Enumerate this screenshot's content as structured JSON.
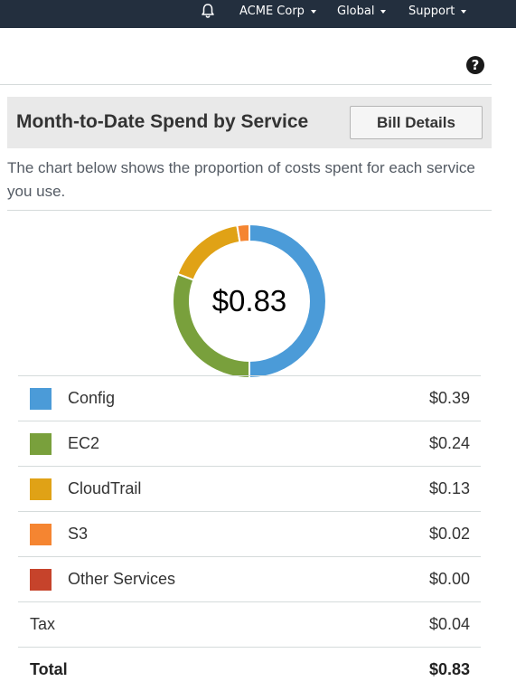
{
  "topbar": {
    "account": "ACME Corp",
    "region": "Global",
    "support": "Support"
  },
  "help_icon": "?",
  "panel": {
    "title": "Month-to-Date Spend by Service",
    "bill_details_label": "Bill Details",
    "description": "The chart below shows the proportion of costs spent for each service you use."
  },
  "chart_data": {
    "type": "pie",
    "center_label": "$0.83",
    "categories": [
      "Config",
      "EC2",
      "CloudTrail",
      "S3",
      "Other Services"
    ],
    "values": [
      0.39,
      0.24,
      0.13,
      0.02,
      0.0
    ],
    "colors": [
      "#4b9bd8",
      "#79a03c",
      "#e0a216",
      "#f58531",
      "#c6432b"
    ]
  },
  "services": [
    {
      "name": "Config",
      "amount": "$0.39",
      "color": "#4b9bd8"
    },
    {
      "name": "EC2",
      "amount": "$0.24",
      "color": "#79a03c"
    },
    {
      "name": "CloudTrail",
      "amount": "$0.13",
      "color": "#e0a216"
    },
    {
      "name": "S3",
      "amount": "$0.02",
      "color": "#f58531"
    },
    {
      "name": "Other Services",
      "amount": "$0.00",
      "color": "#c6432b"
    }
  ],
  "tax": {
    "label": "Tax",
    "amount": "$0.04"
  },
  "total": {
    "label": "Total",
    "amount": "$0.83"
  }
}
